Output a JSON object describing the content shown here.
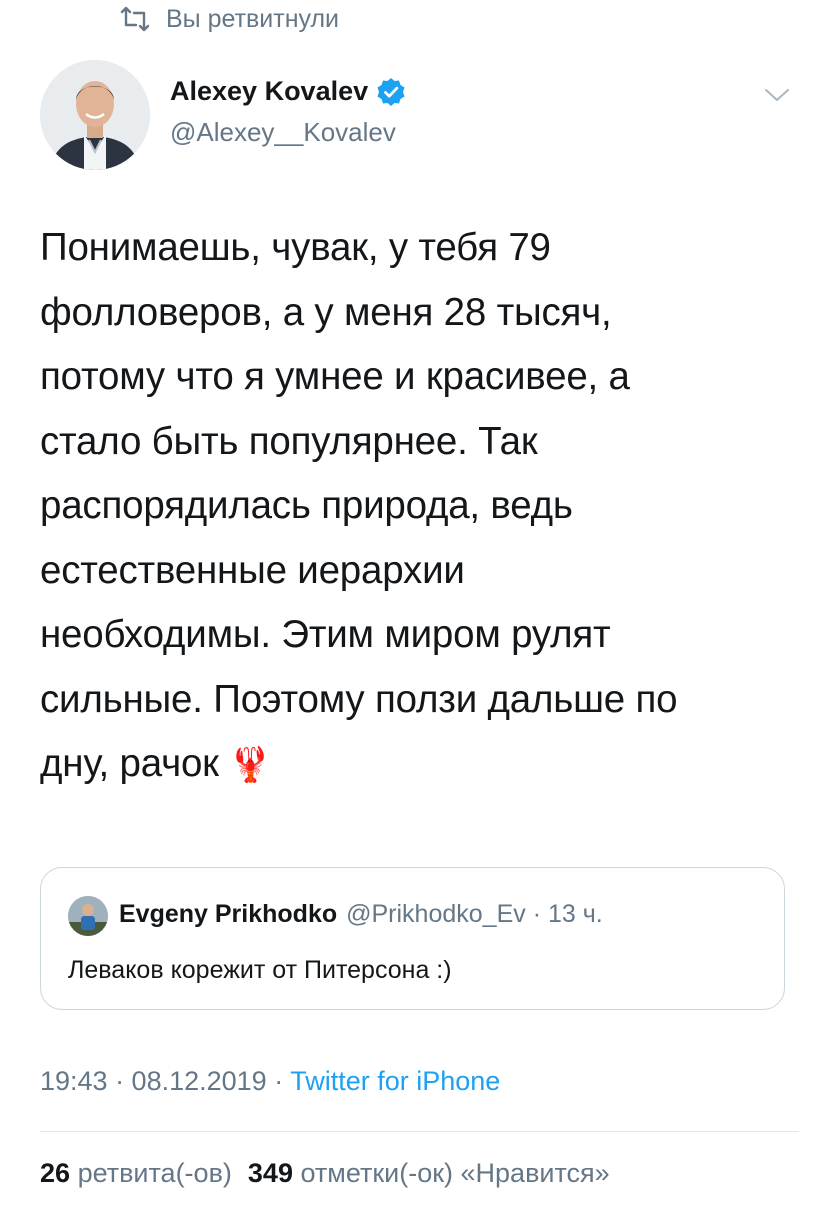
{
  "retweet_context": {
    "text": "Вы ретвитнули",
    "icon": "retweet-icon"
  },
  "author": {
    "name": "Alexey Kovalev",
    "handle": "@Alexey__Kovalev",
    "verified": true,
    "avatar_icon": "avatar-photo"
  },
  "menu": {
    "icon": "chevron-down-icon"
  },
  "tweet": {
    "lines": [
      "Понимаешь, чувак, у тебя 79",
      "фолловеров, а у меня 28 тысяч,",
      "потому что я умнее и красивее, а",
      "стало быть популярнее. Так",
      "распорядилась природа, ведь",
      "естественные иерархии",
      "необходимы. Этим миром рулят",
      "сильные. Поэтому ползи дальше по",
      "дну, рачок"
    ],
    "emoji": "🦞"
  },
  "quote": {
    "name": "Evgeny Prikhodko",
    "handle_time": "@Prikhodko_Ev · 13 ч.",
    "text": "Леваков корежит от Питерсона :)"
  },
  "meta": {
    "time_date": "19:43 · 08.12.2019 · ",
    "source": "Twitter for iPhone"
  },
  "stats": {
    "retweets_count": "26",
    "retweets_label": "ретвита(-ов)",
    "likes_count": "349",
    "likes_label": "отметки(-ок) «Нравится»"
  },
  "colors": {
    "text": "#14171a",
    "secondary": "#657786",
    "link": "#1da1f2",
    "verified": "#1da1f2",
    "border": "#ccd6dd"
  }
}
